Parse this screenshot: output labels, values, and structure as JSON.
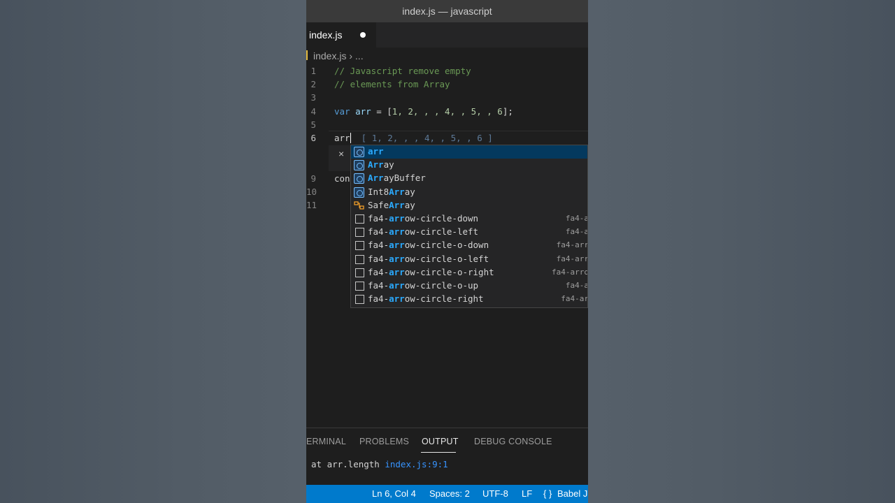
{
  "window": {
    "title": "index.js — javascript"
  },
  "tab": {
    "label": "index.js"
  },
  "breadcrumb": {
    "file": "index.js",
    "sep": "›",
    "more": "..."
  },
  "code": {
    "line_numbers": [
      "1",
      "2",
      "3",
      "4",
      "5",
      "6",
      "9",
      "10",
      "11"
    ],
    "line1": "// Javascript remove empty",
    "line2": "// elements from Array",
    "line4_kw": "var",
    "line4_var": "arr",
    "line4_eq": " = [",
    "line4_vals": "1, 2, , , 4, , 5, , 6",
    "line4_end": "];",
    "line6_text": "arr",
    "line6_hint": "[ 1, 2, , , 4, , 5, , 6 ]",
    "line9_text": "con"
  },
  "peek": {
    "close": "×"
  },
  "suggest": {
    "items": [
      {
        "pre": "",
        "match": "arr",
        "post": "",
        "icon": "variable-icon",
        "detail": ""
      },
      {
        "pre": "",
        "match": "Arr",
        "post": "ay",
        "icon": "variable-icon",
        "detail": ""
      },
      {
        "pre": "",
        "match": "Arr",
        "post": "ayBuffer",
        "icon": "variable-icon",
        "detail": ""
      },
      {
        "pre": "Int8",
        "match": "Arr",
        "post": "ay",
        "icon": "variable-icon",
        "detail": ""
      },
      {
        "pre": "Safe",
        "match": "Arr",
        "post": "ay",
        "icon": "class-icon",
        "detail": ""
      },
      {
        "pre": "fa4-",
        "match": "arr",
        "post": "ow-circle-down",
        "icon": "text-icon",
        "detail": "fa4-a"
      },
      {
        "pre": "fa4-",
        "match": "arr",
        "post": "ow-circle-left",
        "icon": "text-icon",
        "detail": "fa4-a"
      },
      {
        "pre": "fa4-",
        "match": "arr",
        "post": "ow-circle-o-down",
        "icon": "text-icon",
        "detail": "fa4-arr"
      },
      {
        "pre": "fa4-",
        "match": "arr",
        "post": "ow-circle-o-left",
        "icon": "text-icon",
        "detail": "fa4-arr"
      },
      {
        "pre": "fa4-",
        "match": "arr",
        "post": "ow-circle-o-right",
        "icon": "text-icon",
        "detail": "fa4-arro"
      },
      {
        "pre": "fa4-",
        "match": "arr",
        "post": "ow-circle-o-up",
        "icon": "text-icon",
        "detail": "fa4-a"
      },
      {
        "pre": "fa4-",
        "match": "arr",
        "post": "ow-circle-right",
        "icon": "text-icon",
        "detail": "fa4-ar"
      }
    ]
  },
  "panel": {
    "tabs": [
      "ERMINAL",
      "PROBLEMS",
      "OUTPUT",
      "DEBUG CONSOLE"
    ],
    "active_tab": "OUTPUT",
    "output_text": "at arr.length ",
    "output_link": "index.js:9:1"
  },
  "status": {
    "position": "Ln 6, Col 4",
    "spaces": "Spaces: 2",
    "encoding": "UTF-8",
    "eol": "LF",
    "language_icon": "{ }",
    "language": "Babel J"
  },
  "colors": {
    "accent": "#007acc",
    "selection": "#04395e",
    "match": "#2aaaff",
    "comment": "#6a9955",
    "keyword": "#569cd6",
    "number": "#b5cea8"
  }
}
